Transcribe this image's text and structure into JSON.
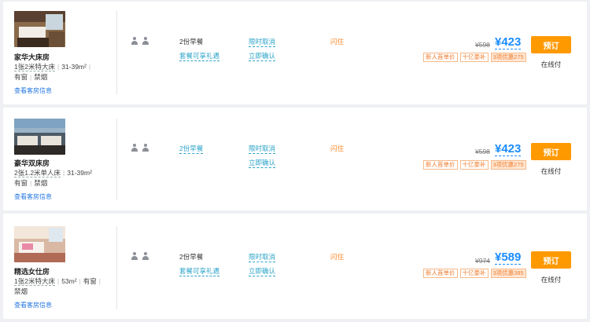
{
  "rooms": [
    {
      "name": "家华大床房",
      "bed": "1张2米特大床",
      "area": "31-39m²",
      "window": "有窗",
      "smoking": "禁烟",
      "info_link": "查看客房信息",
      "breakfast": "2份早餐",
      "breakfast_blue": false,
      "perk": "套餐可享礼遇",
      "cancel": "限时取消",
      "confirm": "立即确认",
      "flash": "闪住",
      "original_price": "¥598",
      "price": "¥423",
      "tags": [
        "新人首单价",
        "十亿豪补",
        "3项优惠275"
      ],
      "book_label": "预订",
      "pay_label": "在线付"
    },
    {
      "name": "豪华双床房",
      "bed": "2张1.2米单人床",
      "area": "31-39m²",
      "window": "有窗",
      "smoking": "禁烟",
      "info_link": "查看客房信息",
      "breakfast": "2份早餐",
      "breakfast_blue": true,
      "perk": "",
      "cancel": "限时取消",
      "confirm": "立即确认",
      "flash": "闪住",
      "original_price": "¥598",
      "price": "¥423",
      "tags": [
        "新人首单价",
        "十亿豪补",
        "3项优惠275"
      ],
      "book_label": "预订",
      "pay_label": "在线付"
    },
    {
      "name": "精选女仕房",
      "bed": "1张2米特大床",
      "area": "53m²",
      "window": "有窗",
      "smoking": "禁烟",
      "info_link": "查看客房信息",
      "breakfast": "2份早餐",
      "breakfast_blue": false,
      "perk": "套餐可享礼遇",
      "cancel": "限时取消",
      "confirm": "立即确认",
      "flash": "闪住",
      "original_price": "¥974",
      "price": "¥589",
      "tags": [
        "新人首单价",
        "十亿豪补",
        "3项优惠385"
      ],
      "book_label": "预订",
      "pay_label": "在线付"
    }
  ],
  "colors": {
    "accent_blue": "#1a8cff",
    "link_teal": "#2aa3c8",
    "book_orange": "#ff9900",
    "promo_orange": "#f07d2e"
  }
}
